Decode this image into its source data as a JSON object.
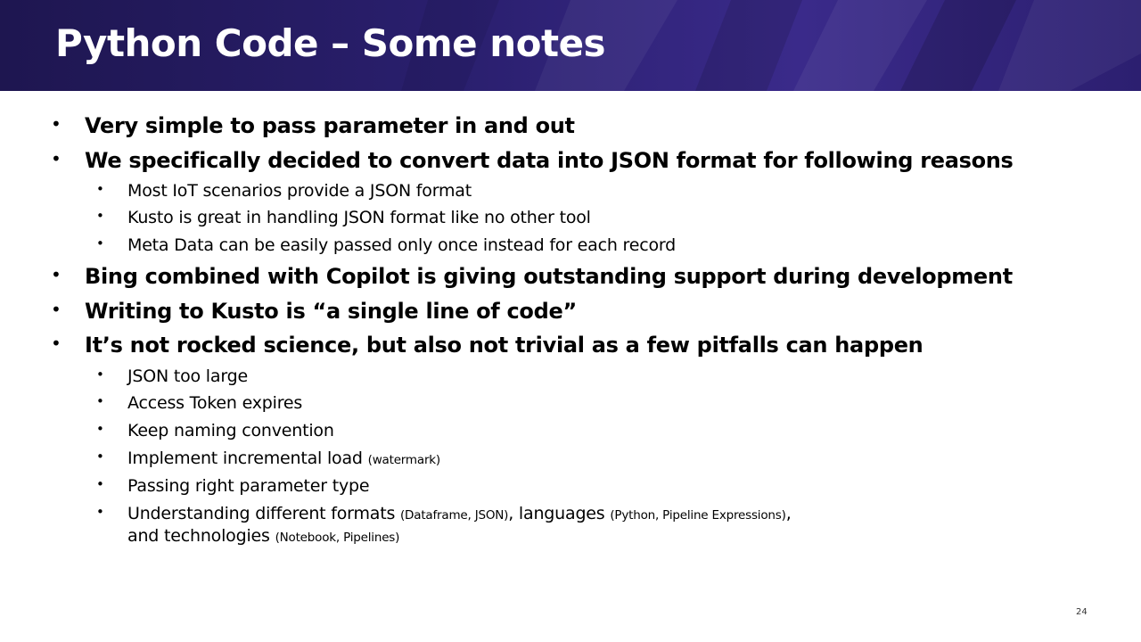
{
  "slide": {
    "title": "Python Code – Some notes",
    "page_number": "24"
  },
  "bullets": [
    {
      "level": 1,
      "text": "Very simple to pass parameter in and out"
    },
    {
      "level": 1,
      "text": "We specifically decided to convert data into JSON format for following reasons"
    },
    {
      "level": 2,
      "text": "Most IoT scenarios provide a JSON format"
    },
    {
      "level": 2,
      "text": "Kusto is great in handling JSON format like no other tool"
    },
    {
      "level": 2,
      "text": "Meta Data can be easily passed only once instead for each record"
    },
    {
      "level": 1,
      "text": "Bing combined with Copilot is giving outstanding support during development"
    },
    {
      "level": 1,
      "text": "Writing to Kusto is “a single line of code”"
    },
    {
      "level": 1,
      "text": "It’s not rocked science, but also not trivial as a few pitfalls can happen"
    },
    {
      "level": 2,
      "text": "JSON too large"
    },
    {
      "level": 2,
      "text": "Access Token expires"
    },
    {
      "level": 2,
      "text": "Keep naming convention"
    },
    {
      "level": 2,
      "text": "Implement incremental load",
      "note": "(watermark)"
    },
    {
      "level": 2,
      "text": "Passing right parameter type"
    }
  ],
  "last_bullet": {
    "part1": "Understanding different formats ",
    "note1": "(Dataframe, JSON)",
    "part2": ", languages ",
    "note2": "(Python, Pipeline Expressions)",
    "part3": ",",
    "part4": "and technologies ",
    "note3": "(Notebook, Pipelines)"
  },
  "bullet_glyph": "•"
}
